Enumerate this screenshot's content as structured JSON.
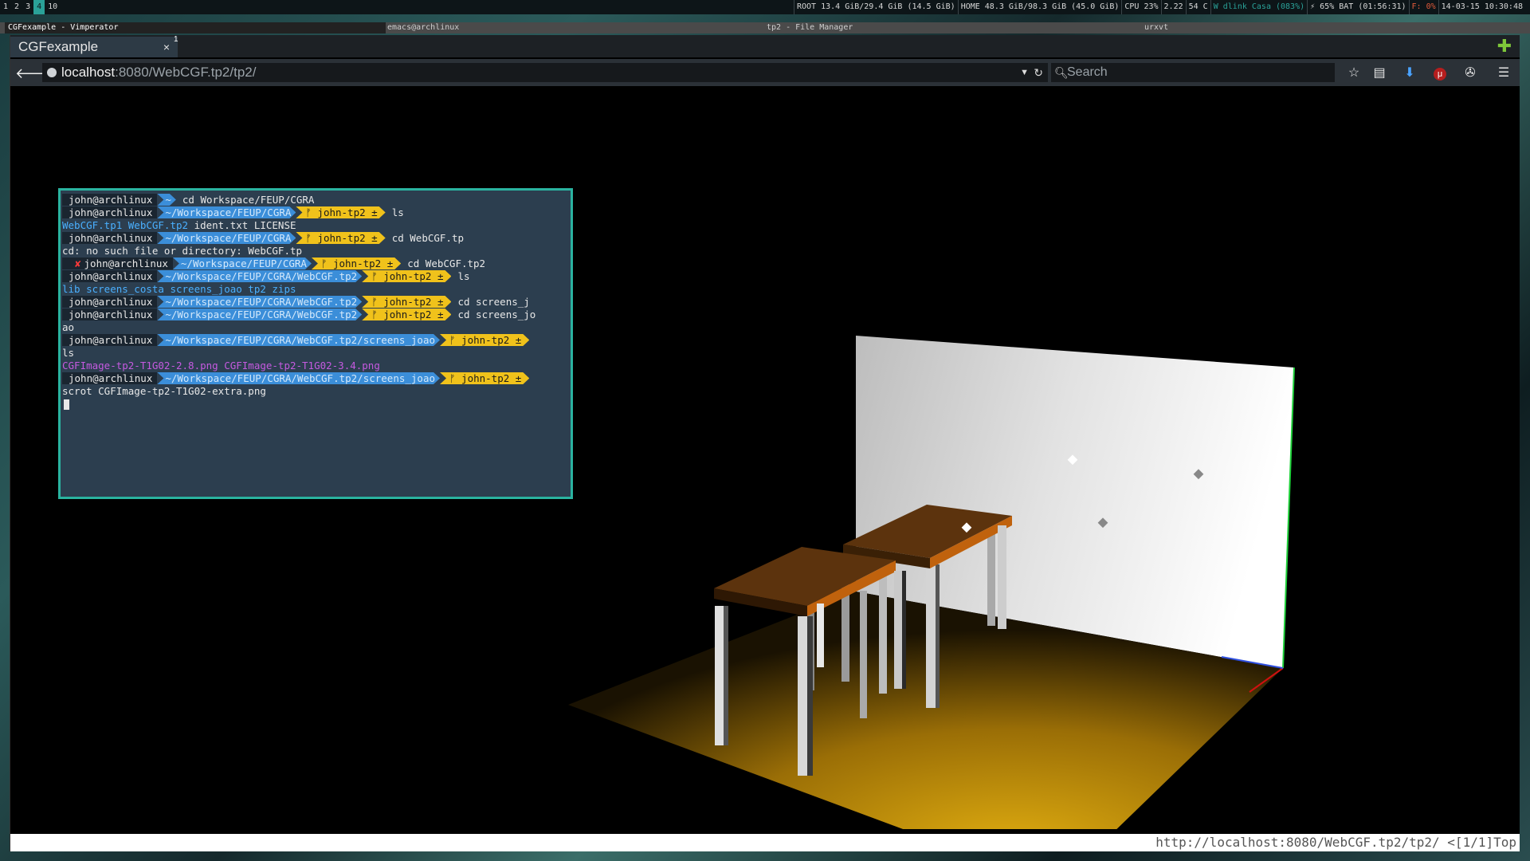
{
  "topbar": {
    "workspaces": [
      "1",
      "2",
      "3",
      "4",
      "10"
    ],
    "active_workspace": "4",
    "stats": {
      "root": "ROOT 13.4 GiB/29.4 GiB (14.5 GiB)",
      "home": "HOME 48.3 GiB/98.3 GiB (45.0 GiB)",
      "cpu": "CPU 23%",
      "load": "2.22",
      "temp": "54 C",
      "wifi": "W dlink Casa (083%)",
      "battery": "⚡ 65% BAT (01:56:31)",
      "fan": "F: 0%",
      "datetime": "14-03-15 10:30:48"
    }
  },
  "window_titles": {
    "active": "CGFexample - Vimperator",
    "t2": "emacs@archlinux",
    "t3": "tp2 - File Manager",
    "t4": "urxvt"
  },
  "browser": {
    "tab_title": "CGFexample",
    "tab_close": "×",
    "tab_number": "1",
    "new_tab": "✚",
    "url_host": "localhost",
    "url_rest": ":8080/WebCGF.tp2/tp2/",
    "search_placeholder": "Search",
    "status_text": "http://localhost:8080/WebCGF.tp2/tp2/ <[1/1]Top"
  },
  "icons": {
    "back": "back-arrow-icon",
    "globe": "site-identity-icon",
    "bookmark": "star-icon",
    "reader": "clipboard-icon",
    "download": "download-icon",
    "ublock": "ublock-icon",
    "addon": "puzzle-icon",
    "menu": "hamburger-menu-icon"
  },
  "terminal": {
    "user": "john@archlinux",
    "lines": [
      {
        "path": "~",
        "branch": "",
        "cmd": "cd Workspace/FEUP/CGRA"
      },
      {
        "path": "~/Workspace/FEUP/CGRA",
        "branch": "ᚠ john-tp2 ±",
        "cmd": "ls"
      },
      {
        "out": "WebCGF.tp1  WebCGF.tp2",
        "out2": "  ident.txt  LICENSE"
      },
      {
        "path": "~/Workspace/FEUP/CGRA",
        "branch": "ᚠ john-tp2 ±",
        "cmd": "cd WebCGF.tp"
      },
      {
        "out_plain": "cd: no such file or directory: WebCGF.tp"
      },
      {
        "err": "✘",
        "path": "~/Workspace/FEUP/CGRA",
        "branch": "ᚠ john-tp2 ±",
        "cmd": "cd WebCGF.tp2"
      },
      {
        "path": "~/Workspace/FEUP/CGRA/WebCGF.tp2",
        "branch": "ᚠ john-tp2 ±",
        "cmd": "ls"
      },
      {
        "out": "lib  screens_costa  screens_joao  tp2  zips"
      },
      {
        "path": "~/Workspace/FEUP/CGRA/WebCGF.tp2",
        "branch": "ᚠ john-tp2 ±",
        "cmd": "cd screens_j"
      },
      {
        "path": "~/Workspace/FEUP/CGRA/WebCGF.tp2",
        "branch": "ᚠ john-tp2 ±",
        "cmd": "cd screens_jo"
      },
      {
        "out_plain": "ao"
      },
      {
        "path": "~/Workspace/FEUP/CGRA/WebCGF.tp2/screens_joao",
        "branch": "ᚠ john-tp2 ±",
        "cmd": ""
      },
      {
        "out_plain": "ls"
      },
      {
        "img": "CGFImage-tp2-T1G02-2.8.png  CGFImage-tp2-T1G02-3.4.png"
      },
      {
        "path": "~/Workspace/FEUP/CGRA/WebCGF.tp2/screens_joao",
        "branch": "ᚠ john-tp2 ±",
        "cmd": ""
      },
      {
        "out_plain": "scrot CGFImage-tp2-T1G02-extra.png"
      }
    ]
  },
  "scene": {
    "description_colors": {
      "floor": "#d4a20c",
      "wall": "#e8e8e8",
      "table_top": "#6b3a10",
      "table_edge": "#c9650e",
      "leg": "#cfcfcf"
    }
  }
}
